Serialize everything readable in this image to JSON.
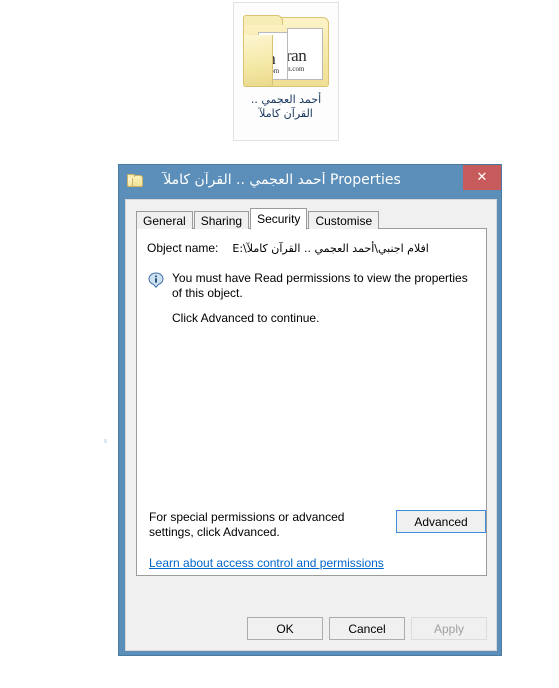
{
  "desktop": {
    "icon": {
      "name": "folder-quran-ahmad-alajmi",
      "label_line1": "أحمد العجمي ..",
      "label_line2": "القرآن كاملآ",
      "thumb1_top": "ran",
      "thumb1_bottom": "uran.com",
      "thumb2_top": "ran",
      "thumb2_bottom": "an.com",
      "selected": true
    }
  },
  "dialog": {
    "titlebar": {
      "icon": "folder-icon",
      "title": "أحمد العجمي .. القرآن كاملآ Properties",
      "close_label": "✕"
    },
    "tabs": [
      {
        "label": "General",
        "active": false
      },
      {
        "label": "Sharing",
        "active": false
      },
      {
        "label": "Security",
        "active": true
      },
      {
        "label": "Customise",
        "active": false
      }
    ],
    "security_tab": {
      "object_name_label": "Object name:",
      "object_name_value": "E:\\افلام اجنبي\\أحمد العجمي .. القرآن كاملآ",
      "info_icon": "info-icon",
      "info_message": "You must have Read permissions to view the properties of this object.",
      "click_advanced_text": "Click Advanced to continue.",
      "advanced_hint_line1": "For special permissions or advanced settings,",
      "advanced_hint_line2": "click Advanced.",
      "advanced_button": "Advanced",
      "learn_link": "Learn about access control and permissions"
    },
    "footer": {
      "ok": "OK",
      "cancel": "Cancel",
      "apply": "Apply",
      "apply_disabled": true
    }
  },
  "colors": {
    "titlebar_blue": "#5b8fb9",
    "close_red": "#c75b5b",
    "link_blue": "#0066cc",
    "focus_blue": "#3c8dde",
    "label_text_blue": "#17365d"
  }
}
